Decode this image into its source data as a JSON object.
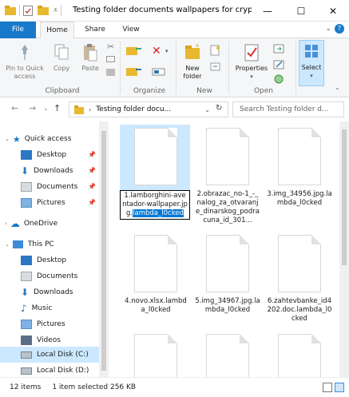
{
  "window": {
    "title": "Testing folder documents  wallpapers for cryptol...",
    "controls": {
      "minimize": "—",
      "maximize": "☐",
      "close": "✕"
    }
  },
  "ribbon_tabs": [
    "File",
    "Home",
    "Share",
    "View"
  ],
  "ribbon": {
    "clipboard": {
      "pin_label": "Pin to Quick access",
      "copy_label": "Copy",
      "paste_label": "Paste",
      "group_label": "Clipboard"
    },
    "organize": {
      "group_label": "Organize"
    },
    "new": {
      "new_folder_label": "New folder",
      "group_label": "New"
    },
    "open": {
      "properties_label": "Properties",
      "group_label": "Open"
    },
    "select": {
      "select_label": "Select"
    }
  },
  "address_bar": {
    "path": "Testing folder docu...",
    "search_placeholder": "Search Testing folder d..."
  },
  "sidebar": {
    "items": [
      {
        "label": "Quick access",
        "icon": "star-icon"
      },
      {
        "label": "Desktop",
        "icon": "desktop-icon"
      },
      {
        "label": "Downloads",
        "icon": "download-icon"
      },
      {
        "label": "Documents",
        "icon": "documents-icon"
      },
      {
        "label": "Pictures",
        "icon": "pictures-icon"
      },
      {
        "label": "OneDrive",
        "icon": "cloud-icon"
      },
      {
        "label": "This PC",
        "icon": "computer-icon"
      },
      {
        "label": "Desktop",
        "icon": "desktop-icon"
      },
      {
        "label": "Documents",
        "icon": "documents-icon"
      },
      {
        "label": "Downloads",
        "icon": "download-icon"
      },
      {
        "label": "Music",
        "icon": "music-icon"
      },
      {
        "label": "Pictures",
        "icon": "pictures-icon"
      },
      {
        "label": "Videos",
        "icon": "video-icon"
      },
      {
        "label": "Local Disk (C:)",
        "icon": "disk-icon"
      },
      {
        "label": "Local Disk (D:)",
        "icon": "disk-icon"
      }
    ]
  },
  "files": [
    {
      "name_prefix": "1.lamborghini-aventador-wallpaper.jpg.",
      "name_selected": "lambda_l0cked"
    },
    {
      "name": "2.obrazac_no-1_-_nalog_za_otvaranje_dinarskog_podracuna_id_301..."
    },
    {
      "name": "3.img_34956.jpg.lambda_l0cked"
    },
    {
      "name": "4.novo.xlsx.lambda_l0cked"
    },
    {
      "name": "5.img_34967.jpg.lambda_l0cked"
    },
    {
      "name": "6.zahtevbanke_id4202.doc.lambda_l0cked"
    }
  ],
  "status": {
    "item_count": "12 items",
    "selection": "1 item selected  256 KB"
  },
  "colors": {
    "accent": "#1979ca",
    "selection": "#cce8ff",
    "highlight": "#0078d7"
  }
}
